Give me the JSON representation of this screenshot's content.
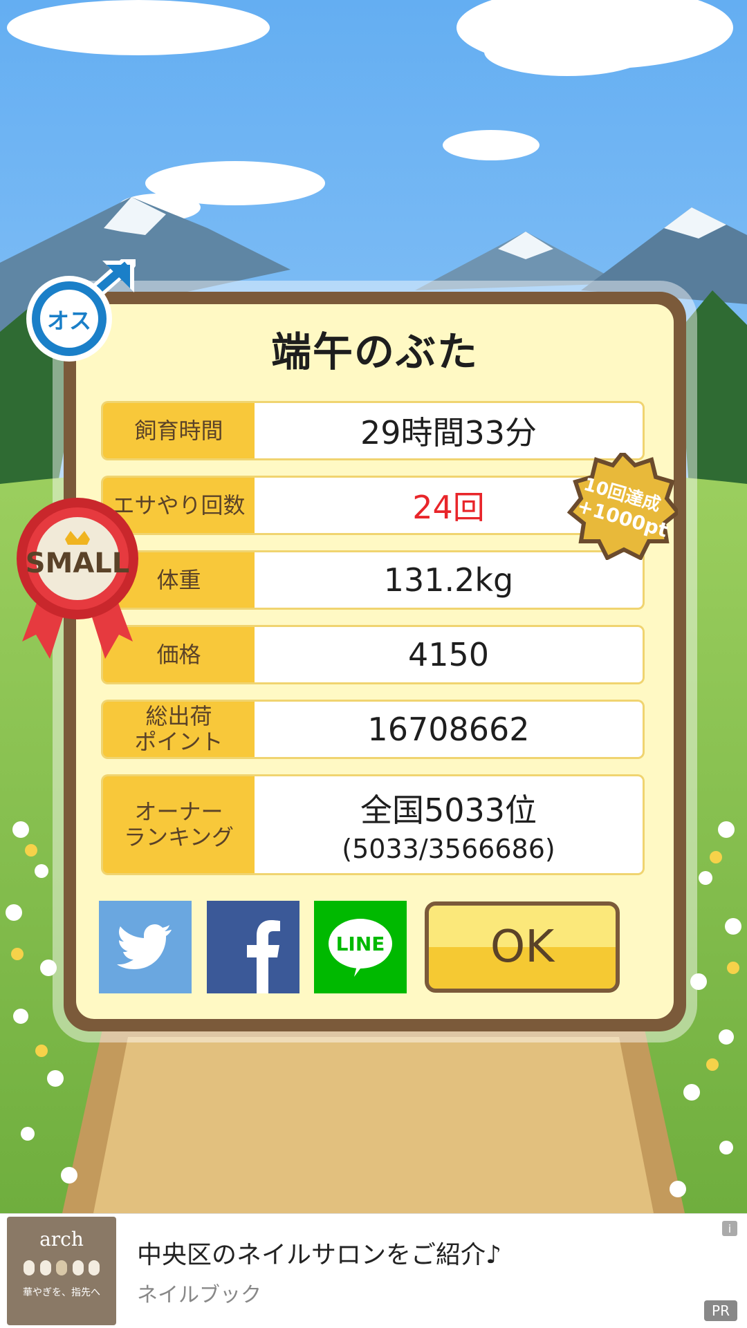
{
  "pig": {
    "name": "端午のぶた",
    "gender_badge": "オス",
    "size_badge": "SMALL"
  },
  "achievement_badge": {
    "line1": "10回達成",
    "line2": "+1000pt"
  },
  "stats": [
    {
      "label": "飼育時間",
      "value": "29時間33分"
    },
    {
      "label": "エサやり回数",
      "value": "24回"
    },
    {
      "label": "体重",
      "value": "131.2kg"
    },
    {
      "label": "価格",
      "value": "4150"
    },
    {
      "label": "総出荷\nポイント",
      "value": "16708662"
    },
    {
      "label": "オーナー\nランキング",
      "value": "全国5033位",
      "sub": "(5033/3566686)"
    }
  ],
  "share": {
    "twitter_color": "#6aa7e0",
    "facebook_color": "#3b5998",
    "line_color": "#00b900",
    "line_label": "LINE"
  },
  "ok_button": "OK",
  "ad": {
    "thumb_title": "arch",
    "thumb_caption": "華やぎを、指先へ",
    "title": "中央区のネイルサロンをご紹介♪",
    "source": "ネイルブック",
    "pr_label": "PR",
    "info_label": "i"
  }
}
